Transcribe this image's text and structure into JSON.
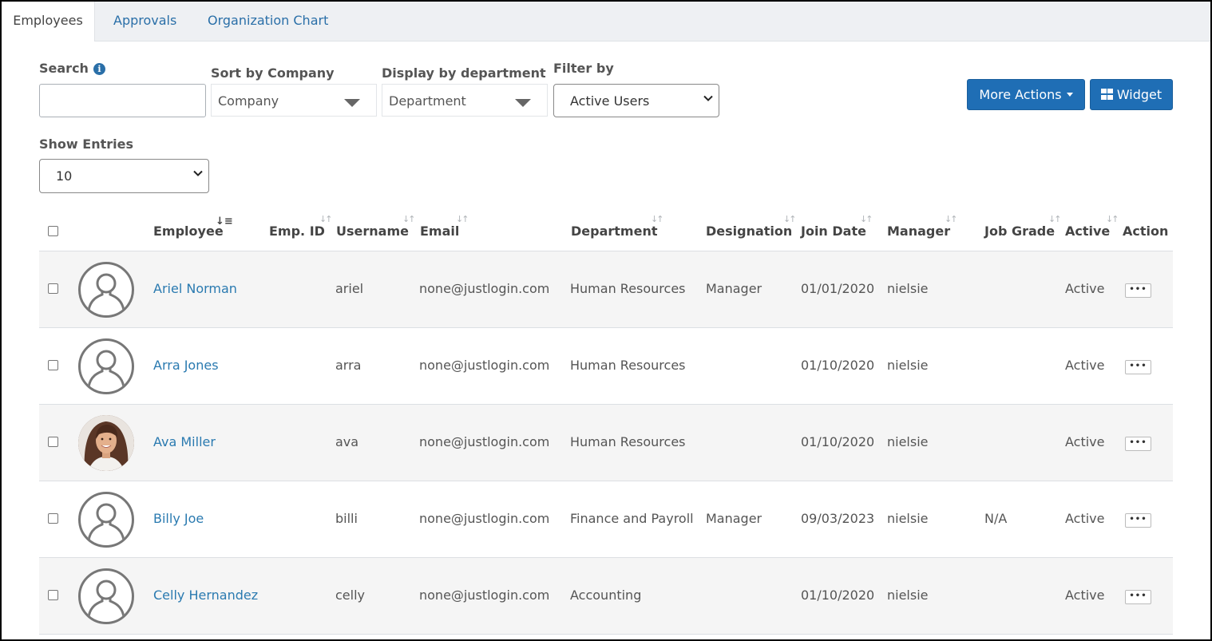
{
  "tabs": [
    {
      "label": "Employees",
      "active": true
    },
    {
      "label": "Approvals",
      "active": false
    },
    {
      "label": "Organization Chart",
      "active": false
    }
  ],
  "filters": {
    "search_label": "Search",
    "search_value": "",
    "sort_label": "Sort by Company",
    "sort_value": "Company",
    "dept_label": "Display by department",
    "dept_value": "Department",
    "filter_label": "Filter by",
    "filter_value": "Active Users",
    "entries_label": "Show Entries",
    "entries_value": "10"
  },
  "actions": {
    "more_actions": "More Actions",
    "widget": "Widget"
  },
  "table": {
    "columns": [
      "Employee",
      "Emp. ID",
      "Username",
      "Email",
      "Department",
      "Designation",
      "Join Date",
      "Manager",
      "Job Grade",
      "Active",
      "Action"
    ],
    "rows": [
      {
        "name": "Ariel Norman",
        "emp_id": "",
        "username": "ariel",
        "email": "none@justlogin.com",
        "department": "Human Resources",
        "designation": "Manager",
        "join_date": "01/01/2020",
        "manager": "nielsie",
        "job_grade": "",
        "active": "Active",
        "avatar": "placeholder"
      },
      {
        "name": "Arra Jones",
        "emp_id": "",
        "username": "arra",
        "email": "none@justlogin.com",
        "department": "Human Resources",
        "designation": "",
        "join_date": "01/10/2020",
        "manager": "nielsie",
        "job_grade": "",
        "active": "Active",
        "avatar": "placeholder"
      },
      {
        "name": "Ava Miller",
        "emp_id": "",
        "username": "ava",
        "email": "none@justlogin.com",
        "department": "Human Resources",
        "designation": "",
        "join_date": "01/10/2020",
        "manager": "nielsie",
        "job_grade": "",
        "active": "Active",
        "avatar": "photo"
      },
      {
        "name": "Billy Joe",
        "emp_id": "",
        "username": "billi",
        "email": "none@justlogin.com",
        "department": "Finance and Payroll",
        "designation": "Manager",
        "join_date": "09/03/2023",
        "manager": "nielsie",
        "job_grade": "N/A",
        "active": "Active",
        "avatar": "placeholder"
      },
      {
        "name": "Celly Hernandez",
        "emp_id": "",
        "username": "celly",
        "email": "none@justlogin.com",
        "department": "Accounting",
        "designation": "",
        "join_date": "01/10/2020",
        "manager": "nielsie",
        "job_grade": "",
        "active": "Active",
        "avatar": "placeholder"
      }
    ]
  },
  "icons": {
    "info": "info-icon",
    "user_placeholder": "user-silhouette-icon",
    "sort": "sort-arrows-icon",
    "sort_active": "sort-ascending-icon",
    "more": "ellipsis-icon",
    "widget": "grid-icon",
    "dropdown": "chevron-down-icon"
  },
  "colors": {
    "primary": "#1f6eb5",
    "link": "#2a7ab0",
    "row_alt": "#f5f5f5"
  }
}
